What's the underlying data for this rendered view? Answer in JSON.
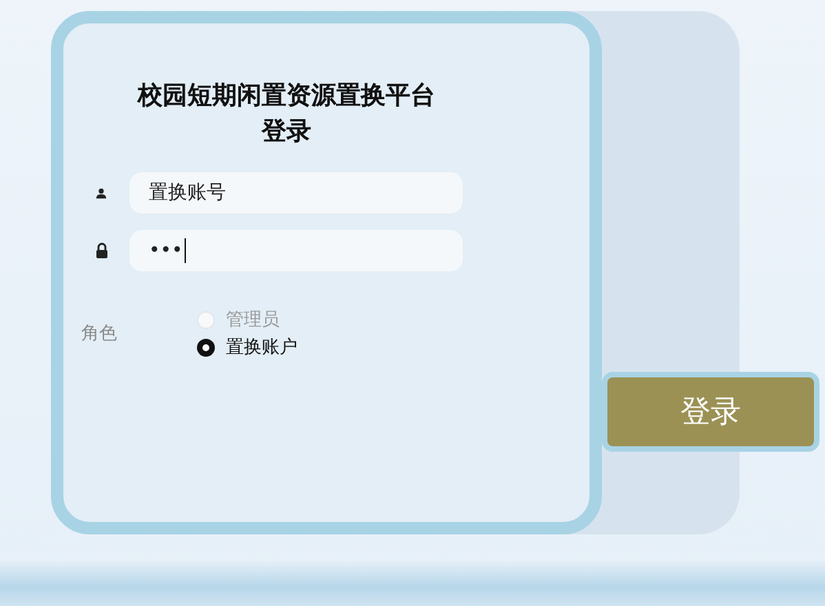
{
  "title_lines": [
    "校园短期闲置资源置换平台",
    "登录"
  ],
  "username": {
    "value": "置换账号"
  },
  "password": {
    "value": "•••"
  },
  "role": {
    "label": "角色",
    "options": [
      {
        "label": "管理员",
        "selected": false
      },
      {
        "label": "置换账户",
        "selected": true
      }
    ]
  },
  "login_button": {
    "label": "登录"
  }
}
